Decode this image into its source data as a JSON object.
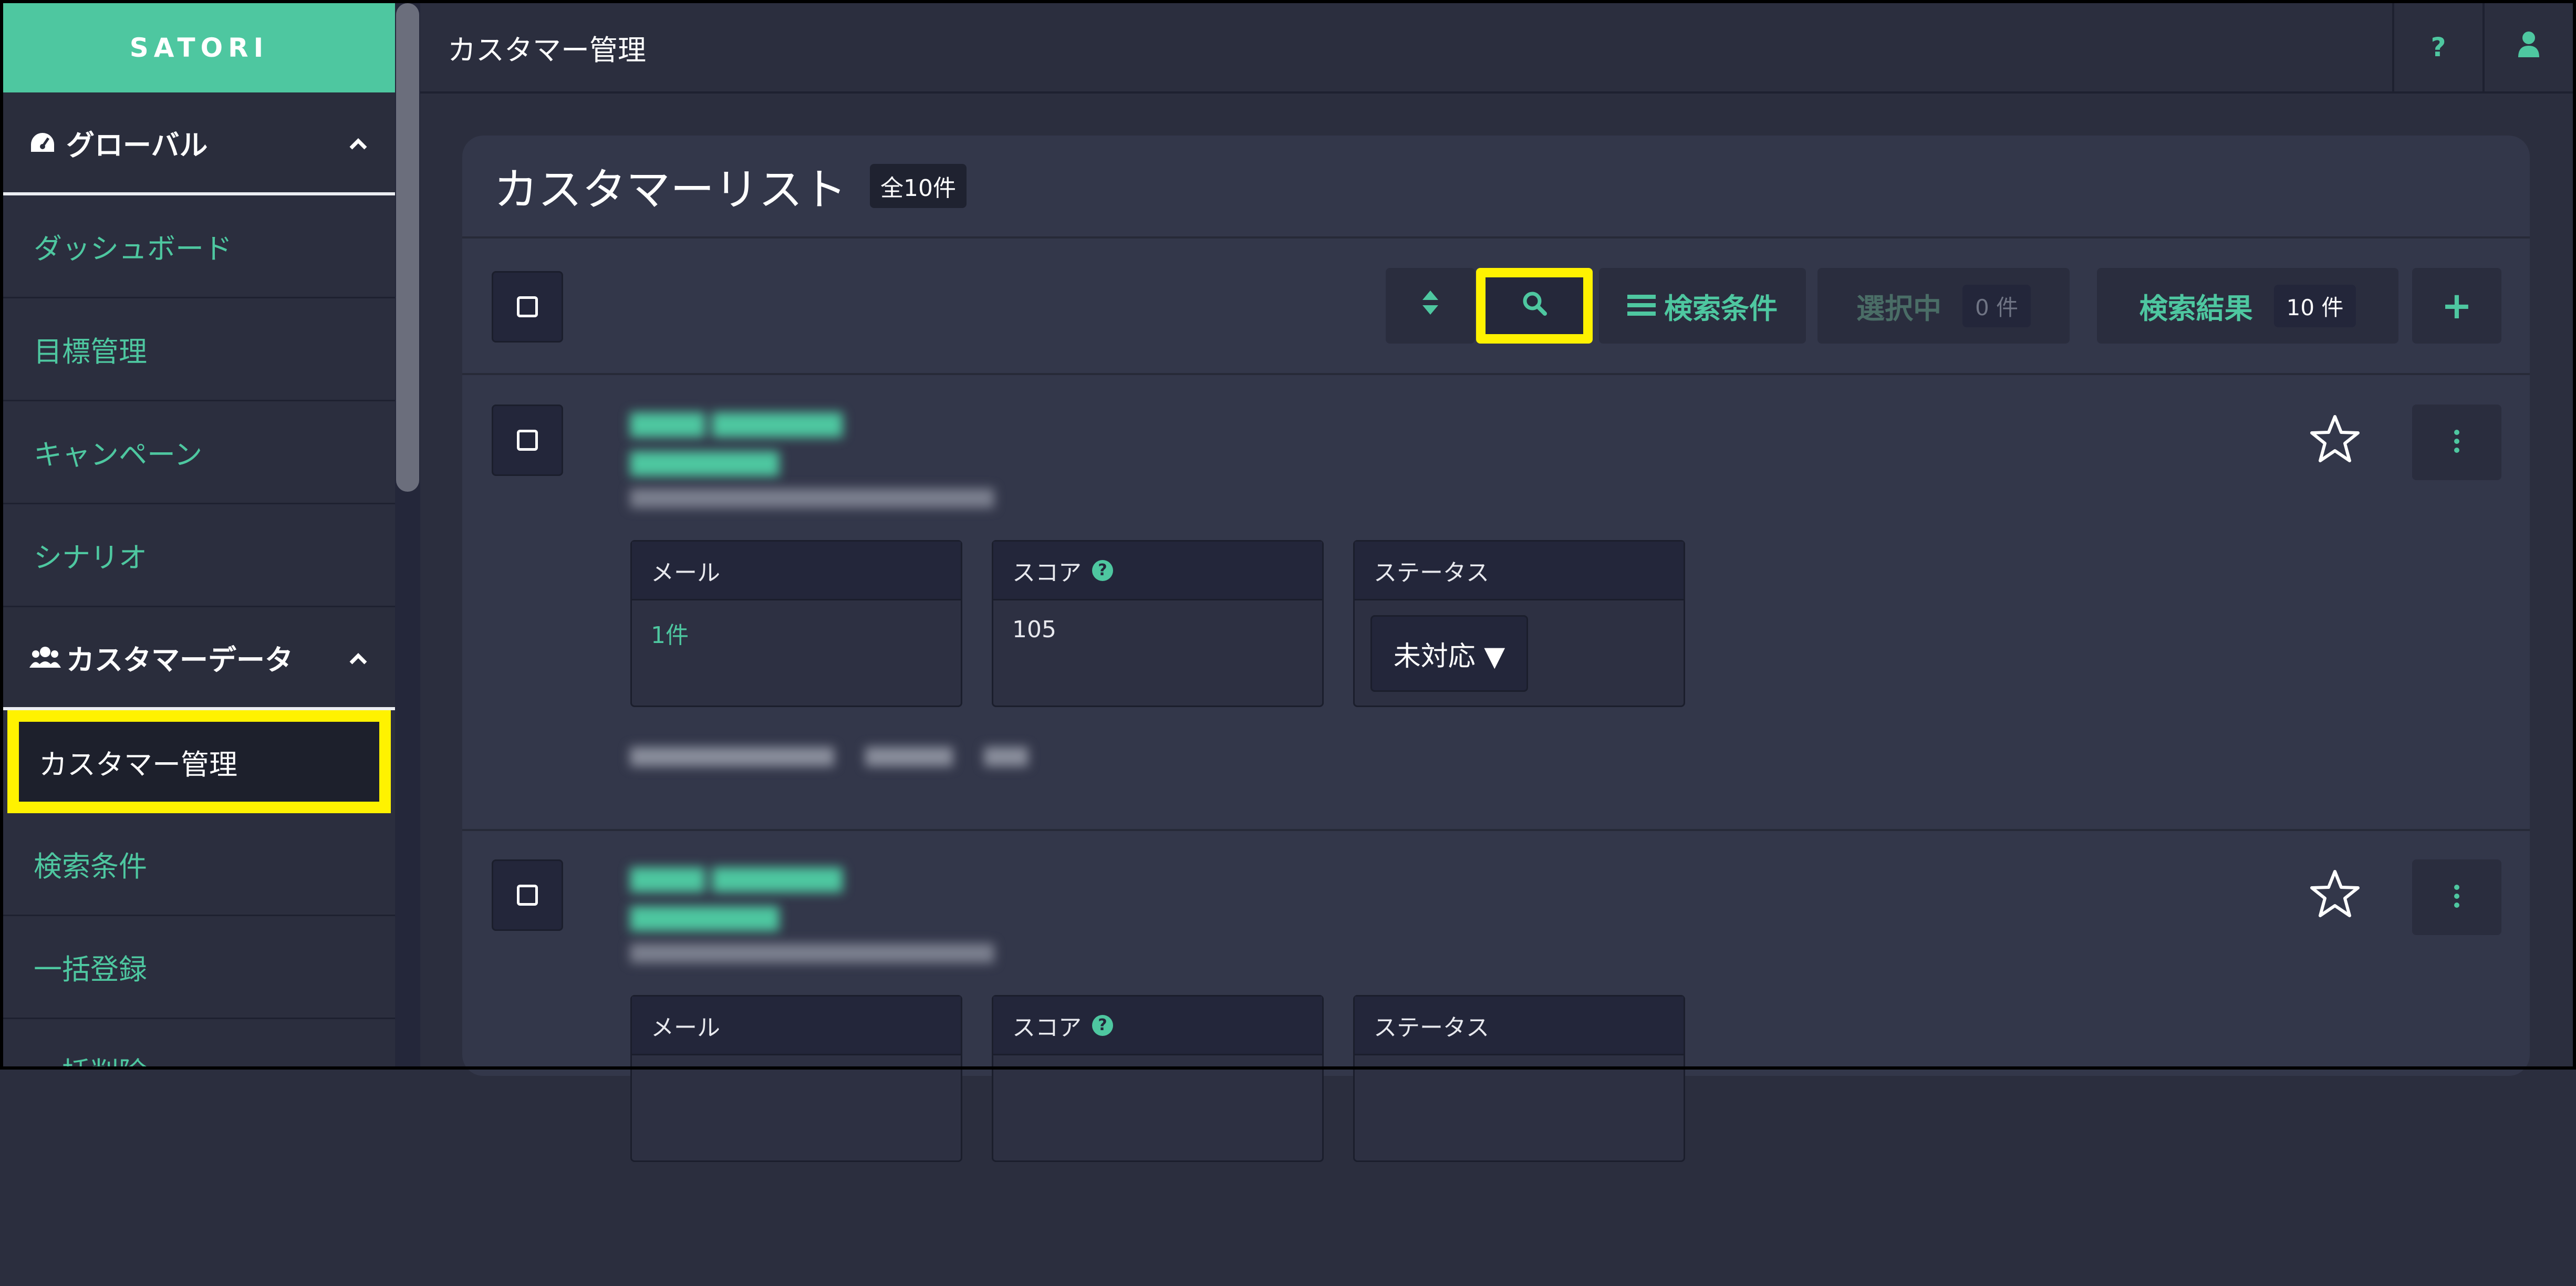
{
  "app": {
    "brand": "SATORI"
  },
  "sidebar": {
    "groups": [
      {
        "label": "グローバル",
        "icon": "dashboard-gauge-icon",
        "expanded": true,
        "items": [
          {
            "label": "ダッシュボード"
          },
          {
            "label": "目標管理"
          },
          {
            "label": "キャンペーン"
          },
          {
            "label": "シナリオ"
          }
        ]
      },
      {
        "label": "カスタマーデータ",
        "icon": "users-icon",
        "expanded": true,
        "items": [
          {
            "label": "カスタマー管理",
            "active": true
          },
          {
            "label": "検索条件"
          },
          {
            "label": "一括登録"
          },
          {
            "label": "一括削除"
          }
        ]
      }
    ]
  },
  "topbar": {
    "title": "カスタマー管理",
    "help_label": "?",
    "user_icon": "user-icon"
  },
  "panel": {
    "title": "カスタマーリスト",
    "count_badge": "全10件"
  },
  "toolbar": {
    "search_conditions_label": "検索条件",
    "selected_label": "選択中",
    "selected_count": "0 件",
    "results_label": "検索結果",
    "results_count": "10 件",
    "add_label": "+"
  },
  "records": [
    {
      "fields": {
        "mail": {
          "header": "メール",
          "value": "1件"
        },
        "score": {
          "header": "スコア",
          "value": "105"
        },
        "status": {
          "header": "ステータス",
          "value": "未対応 ▼"
        }
      }
    },
    {
      "fields": {
        "mail": {
          "header": "メール"
        },
        "score": {
          "header": "スコア"
        },
        "status": {
          "header": "ステータス"
        }
      }
    }
  ],
  "colors": {
    "accent": "#4ec7a0",
    "highlight": "#fff200",
    "background": "#2b2e3e"
  }
}
